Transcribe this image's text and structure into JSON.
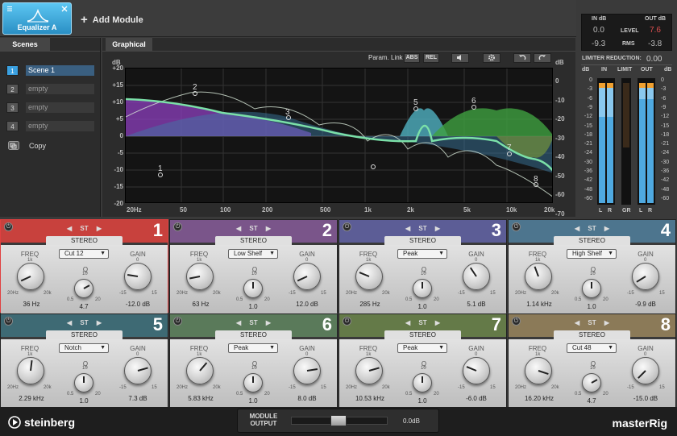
{
  "topbar": {
    "module_name": "Equalizer A",
    "add_module_label": "Add Module"
  },
  "scenes": {
    "tab_label": "Scenes",
    "items": [
      {
        "num": "1",
        "name": "Scene 1",
        "active": true
      },
      {
        "num": "2",
        "name": "empty",
        "active": false
      },
      {
        "num": "3",
        "name": "empty",
        "active": false
      },
      {
        "num": "4",
        "name": "empty",
        "active": false
      }
    ],
    "copy_label": "Copy"
  },
  "graph": {
    "tab_label": "Graphical",
    "param_link_label": "Param. Link",
    "abs_label": "ABS",
    "rel_label": "REL",
    "db_unit": "dB",
    "left_scale": [
      "+20",
      "+15",
      "+10",
      "+5",
      "0",
      "-5",
      "-10",
      "-15",
      "-20"
    ],
    "right_scale": [
      "0",
      "-10",
      "-20",
      "-30",
      "-40",
      "-50",
      "-60",
      "-70"
    ],
    "freq_labels": [
      "20Hz",
      "50",
      "100",
      "200",
      "500",
      "1k",
      "2k",
      "5k",
      "10k",
      "20k"
    ]
  },
  "meters": {
    "in_db_label": "IN dB",
    "out_db_label": "OUT dB",
    "in_level": "0.0",
    "out_level": "7.6",
    "in_rms": "-9.3",
    "out_rms": "-3.8",
    "level_label": "LEVEL",
    "rms_label": "RMS",
    "limiter_reduction_label": "LIMITER REDUCTION:",
    "limiter_reduction_value": "0.00",
    "db_label": "dB",
    "in_label": "IN",
    "limit_label": "LIMIT",
    "out_label": "OUT",
    "gr_label": "GR",
    "l_label": "L",
    "r_label": "R",
    "scale": [
      "0",
      "-3",
      "-6",
      "-9",
      "-12",
      "-15",
      "-18",
      "-21",
      "-24",
      "-30",
      "-36",
      "-42",
      "-48",
      "-60"
    ],
    "accent_color": "#f0a030",
    "bar_color": "#4fa9e0"
  },
  "bands": [
    {
      "num": "1",
      "color": "#c8413d",
      "selected": true,
      "st_label": "ST",
      "stereo_label": "STEREO",
      "type": "Cut 12",
      "freq_label": "FREQ",
      "q_label": "Q",
      "gain_label": "GAIN",
      "freq_value": "36 Hz",
      "q_value": "4.7",
      "gain_value": "-12.0 dB",
      "freq_rot": -0.85,
      "q_rot": 0.45,
      "gain_rot": -0.6
    },
    {
      "num": "2",
      "color": "#7a558a",
      "selected": false,
      "st_label": "ST",
      "stereo_label": "STEREO",
      "type": "Low Shelf",
      "freq_label": "FREQ",
      "q_label": "Q",
      "gain_label": "GAIN",
      "freq_value": "63 Hz",
      "q_value": "1.0",
      "gain_value": "12.0 dB",
      "freq_rot": -0.75,
      "q_rot": 0.0,
      "gain_rot": -0.85
    },
    {
      "num": "3",
      "color": "#5c5d96",
      "selected": false,
      "st_label": "ST",
      "stereo_label": "STEREO",
      "type": "Peak",
      "freq_label": "FREQ",
      "q_label": "Q",
      "gain_label": "GAIN",
      "freq_value": "285 Hz",
      "q_value": "1.0",
      "gain_value": "5.1 dB",
      "freq_rot": -0.5,
      "q_rot": 0.0,
      "gain_rot": -0.25
    },
    {
      "num": "4",
      "color": "#4d758e",
      "selected": false,
      "st_label": "ST",
      "stereo_label": "STEREO",
      "type": "High Shelf",
      "freq_label": "FREQ",
      "q_label": "Q",
      "gain_label": "GAIN",
      "freq_value": "1.14 kHz",
      "q_value": "1.0",
      "gain_value": "-9.9 dB",
      "freq_rot": -0.15,
      "q_rot": 0.0,
      "gain_rot": -0.9
    },
    {
      "num": "5",
      "color": "#3e6a74",
      "selected": false,
      "st_label": "ST",
      "stereo_label": "STEREO",
      "type": "Notch",
      "freq_label": "FREQ",
      "q_label": "Q",
      "gain_label": "GAIN",
      "freq_value": "2.29 kHz",
      "q_value": "1.0",
      "gain_value": "7.3 dB",
      "freq_rot": 0.05,
      "q_rot": 0.0,
      "gain_rot": 0.55
    },
    {
      "num": "6",
      "color": "#5a7a5a",
      "selected": false,
      "st_label": "ST",
      "stereo_label": "STEREO",
      "type": "Peak",
      "freq_label": "FREQ",
      "q_label": "Q",
      "gain_label": "GAIN",
      "freq_value": "5.83 kHz",
      "q_value": "1.0",
      "gain_value": "8.0 dB",
      "freq_rot": 0.3,
      "q_rot": 0.0,
      "gain_rot": 0.6
    },
    {
      "num": "7",
      "color": "#647a48",
      "selected": false,
      "st_label": "ST",
      "stereo_label": "STEREO",
      "type": "Peak",
      "freq_label": "FREQ",
      "q_label": "Q",
      "gain_label": "GAIN",
      "freq_value": "10.53 kHz",
      "q_value": "1.0",
      "gain_value": "-6.0 dB",
      "freq_rot": 0.55,
      "q_rot": 0.0,
      "gain_rot": -0.5
    },
    {
      "num": "8",
      "color": "#8b7a58",
      "selected": false,
      "st_label": "ST",
      "stereo_label": "STEREO",
      "type": "Cut 48",
      "freq_label": "FREQ",
      "q_label": "Q",
      "gain_label": "GAIN",
      "freq_value": "16.20 kHz",
      "q_value": "4.7",
      "gain_value": "-15.0 dB",
      "freq_rot": 0.8,
      "q_rot": 0.45,
      "gain_rot": -1.0
    }
  ],
  "band_scales": {
    "freq_min": "20Hz",
    "freq_mid": "1k",
    "freq_max": "20k",
    "q_min": "0.5",
    "q_mid": "10",
    "q_max": "20",
    "gain_min": "-15",
    "gain_mid": "0",
    "gain_max": "15"
  },
  "footer": {
    "brand": "steinberg",
    "product": "masterRig",
    "module_output_label": "MODULE\nOUTPUT",
    "module_output_value": "0.0dB"
  }
}
